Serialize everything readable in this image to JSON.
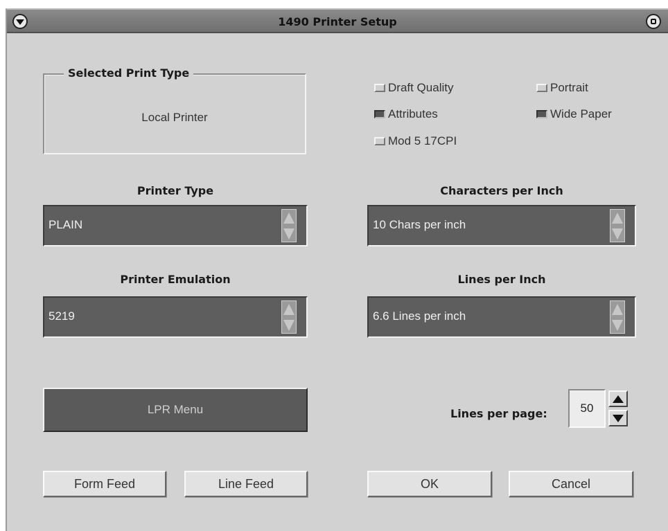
{
  "window": {
    "title": "1490 Printer Setup"
  },
  "selected_print_type": {
    "legend": "Selected Print Type",
    "value": "Local Printer"
  },
  "options": [
    {
      "label": "Draft Quality",
      "checked": false
    },
    {
      "label": "Portrait",
      "checked": false
    },
    {
      "label": "Attributes",
      "checked": true
    },
    {
      "label": "Wide Paper",
      "checked": true
    },
    {
      "label": "Mod 5 17CPI",
      "checked": false
    }
  ],
  "printer_type": {
    "label": "Printer Type",
    "value": "PLAIN"
  },
  "characters_per_inch": {
    "label": "Characters per Inch",
    "value": "10 Chars per inch"
  },
  "printer_emulation": {
    "label": "Printer Emulation",
    "value": "5219"
  },
  "lines_per_inch": {
    "label": "Lines per Inch",
    "value": "6.6 Lines per inch"
  },
  "lpr_menu": {
    "label": "LPR Menu"
  },
  "lines_per_page": {
    "label": "Lines per page:",
    "value": "50"
  },
  "buttons": {
    "form_feed": "Form Feed",
    "line_feed": "Line Feed",
    "ok": "OK",
    "cancel": "Cancel"
  },
  "icons": {
    "window_menu": "window-menu-icon",
    "window_restore": "window-restore-icon",
    "spin_up": "spin-up-icon",
    "spin_down": "spin-down-icon"
  },
  "colors": {
    "dialog_bg": "#d2d2d2",
    "titlebar": "#7a7a7a",
    "spin_field": "#5e5e5e",
    "lpr_button": "#5a5a5a"
  }
}
